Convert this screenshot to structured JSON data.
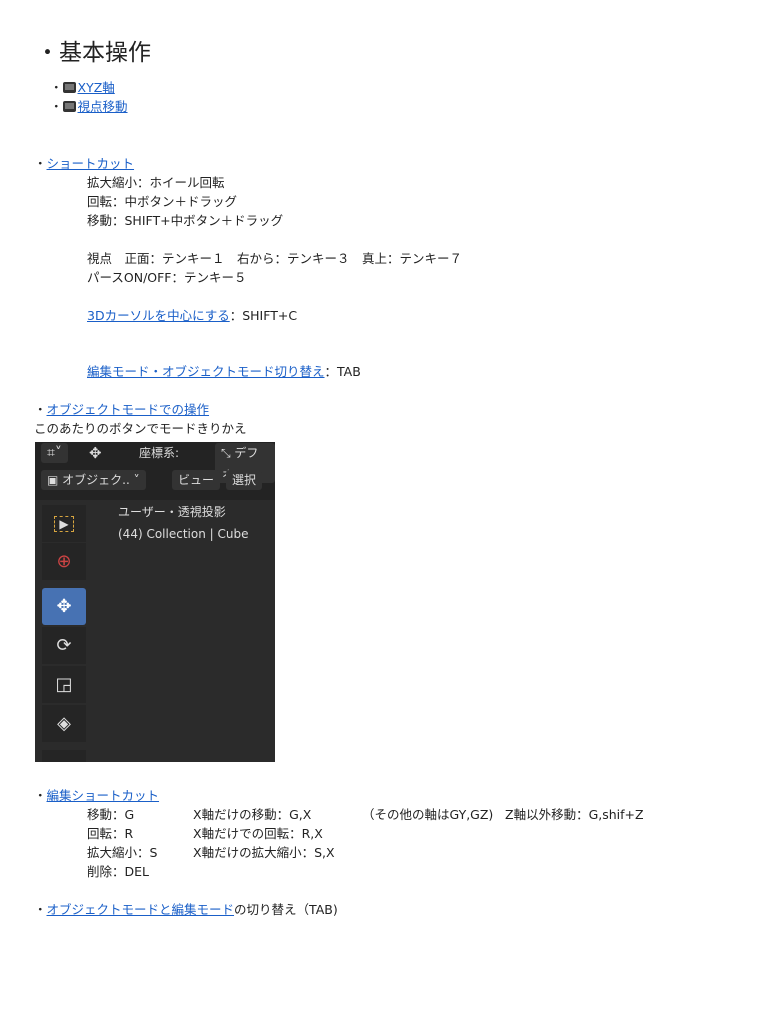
{
  "title": "・基本操作",
  "videos": [
    {
      "label": "XYZ軸"
    },
    {
      "label": "視点移動"
    }
  ],
  "shortcut": {
    "link": "ショートカット",
    "lines": [
      "拡大縮小：ホイール回転",
      "回転：中ボタン＋ドラッグ",
      "移動：SHIFT+中ボタン＋ドラッグ",
      "視点　正面：テンキー１　右から：テンキー３　真上：テンキー７",
      "パースON/OFF：テンキー５"
    ],
    "cursor_link": "3Dカーソルを中心にする",
    "cursor_key": "：SHIFT+C",
    "mode_link": "編集モード・オブジェクトモード切り替え",
    "mode_key": "：TAB"
  },
  "object_mode": {
    "link": "オブジェクトモードでの操作",
    "caption": "このあたりのボタンでモードきりかえ"
  },
  "blender": {
    "coord_label": "座標系:",
    "default": "デフォ",
    "mode": "オブジェク..",
    "view": "ビュー",
    "select": "選択",
    "viewport_title": "ユーザー・透視投影",
    "viewport_info": "(44) Collection | Cube",
    "accent": "#4772b3"
  },
  "edit_shortcut": {
    "link": "編集ショートカット",
    "rows": [
      [
        "移動：G",
        "X軸だけの移動：G,X",
        "（その他の軸はGY,GZ)",
        "Z軸以外移動：G,shif+Z"
      ],
      [
        "回転：R",
        "X軸だけでの回転：R,X"
      ],
      [
        "拡大縮小：S",
        "X軸だけの拡大縮小：S,X"
      ],
      [
        "削除：DEL"
      ]
    ]
  },
  "switch": {
    "link": "オブジェクトモードと編集モード",
    "suffix": "の切り替え（TAB)"
  },
  "bullet": "・"
}
